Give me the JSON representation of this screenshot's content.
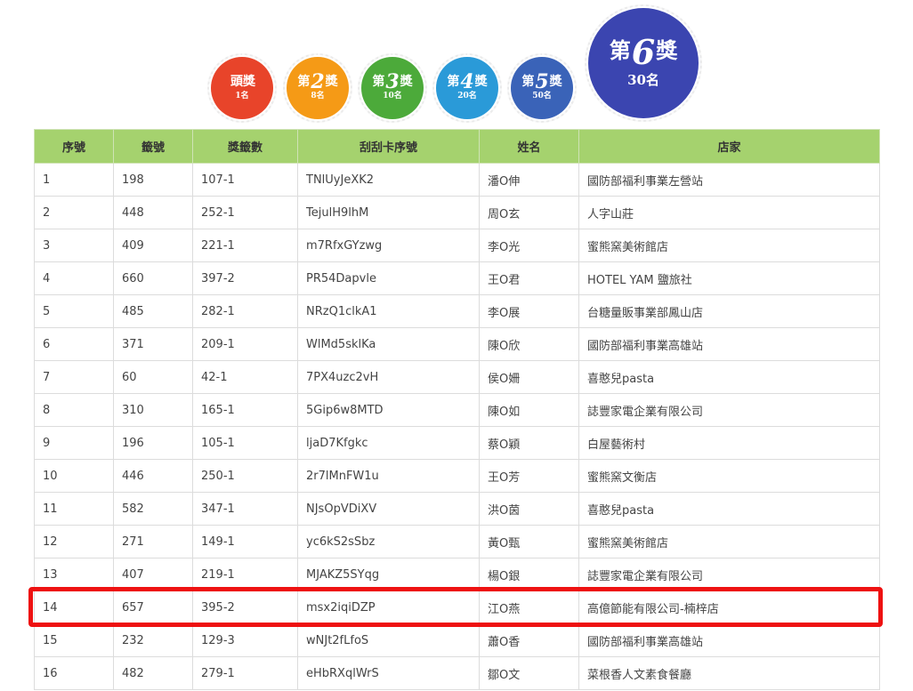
{
  "badges": [
    {
      "prefix": "",
      "num": "",
      "suffix": "頭獎",
      "count": "1名",
      "color": "#e8442a"
    },
    {
      "prefix": "第",
      "num": "2",
      "suffix": "獎",
      "count": "8名",
      "color": "#f59a16"
    },
    {
      "prefix": "第",
      "num": "3",
      "suffix": "獎",
      "count": "10名",
      "color": "#4caa3a"
    },
    {
      "prefix": "第",
      "num": "4",
      "suffix": "獎",
      "count": "20名",
      "color": "#2a9ad8"
    },
    {
      "prefix": "第",
      "num": "5",
      "suffix": "獎",
      "count": "50名",
      "color": "#3a63b8"
    },
    {
      "prefix": "第",
      "num": "6",
      "suffix": "獎",
      "count": "30名",
      "color": "#3b45b0"
    }
  ],
  "table": {
    "headers": [
      "序號",
      "籤號",
      "獎籤數",
      "刮刮卡序號",
      "姓名",
      "店家"
    ],
    "rows": [
      [
        "1",
        "198",
        "107-1",
        "TNlUyJeXK2",
        "潘O伸",
        "國防部福利事業左營站"
      ],
      [
        "2",
        "448",
        "252-1",
        "TejulH9lhM",
        "周O玄",
        "人字山莊"
      ],
      [
        "3",
        "409",
        "221-1",
        "m7RfxGYzwg",
        "李O光",
        "蜜熊窯美術館店"
      ],
      [
        "4",
        "660",
        "397-2",
        "PR54Dapvle",
        "王O君",
        "HOTEL YAM 鹽旅社"
      ],
      [
        "5",
        "485",
        "282-1",
        "NRzQ1clkA1",
        "李O展",
        "台糖量販事業部鳳山店"
      ],
      [
        "6",
        "371",
        "209-1",
        "WlMd5sklKa",
        "陳O欣",
        "國防部福利事業高雄站"
      ],
      [
        "7",
        "60",
        "42-1",
        "7PX4uzc2vH",
        "侯O姍",
        "喜憨兒pasta"
      ],
      [
        "8",
        "310",
        "165-1",
        "5Gip6w8MTD",
        "陳O如",
        "誌豐家電企業有限公司"
      ],
      [
        "9",
        "196",
        "105-1",
        "ljaD7Kfgkc",
        "蔡O穎",
        "白屋藝術村"
      ],
      [
        "10",
        "446",
        "250-1",
        "2r7lMnFW1u",
        "王O芳",
        "蜜熊窯文衡店"
      ],
      [
        "11",
        "582",
        "347-1",
        "NJsOpVDiXV",
        "洪O茵",
        "喜憨兒pasta"
      ],
      [
        "12",
        "271",
        "149-1",
        "yc6kS2sSbz",
        "黃O甄",
        "蜜熊窯美術館店"
      ],
      [
        "13",
        "407",
        "219-1",
        "MJAKZ5SYqg",
        "楊O銀",
        "誌豐家電企業有限公司"
      ],
      [
        "14",
        "657",
        "395-2",
        "msx2iqiDZP",
        "江O燕",
        "高億節能有限公司-楠梓店"
      ],
      [
        "15",
        "232",
        "129-3",
        "wNJt2fLfoS",
        "蕭O香",
        "國防部福利事業高雄站"
      ],
      [
        "16",
        "482",
        "279-1",
        "eHbRXqlWrS",
        "鄒O文",
        "菜根香人文素食餐廳"
      ]
    ]
  },
  "highlight": {
    "row": "14",
    "color": "#ee1111"
  }
}
